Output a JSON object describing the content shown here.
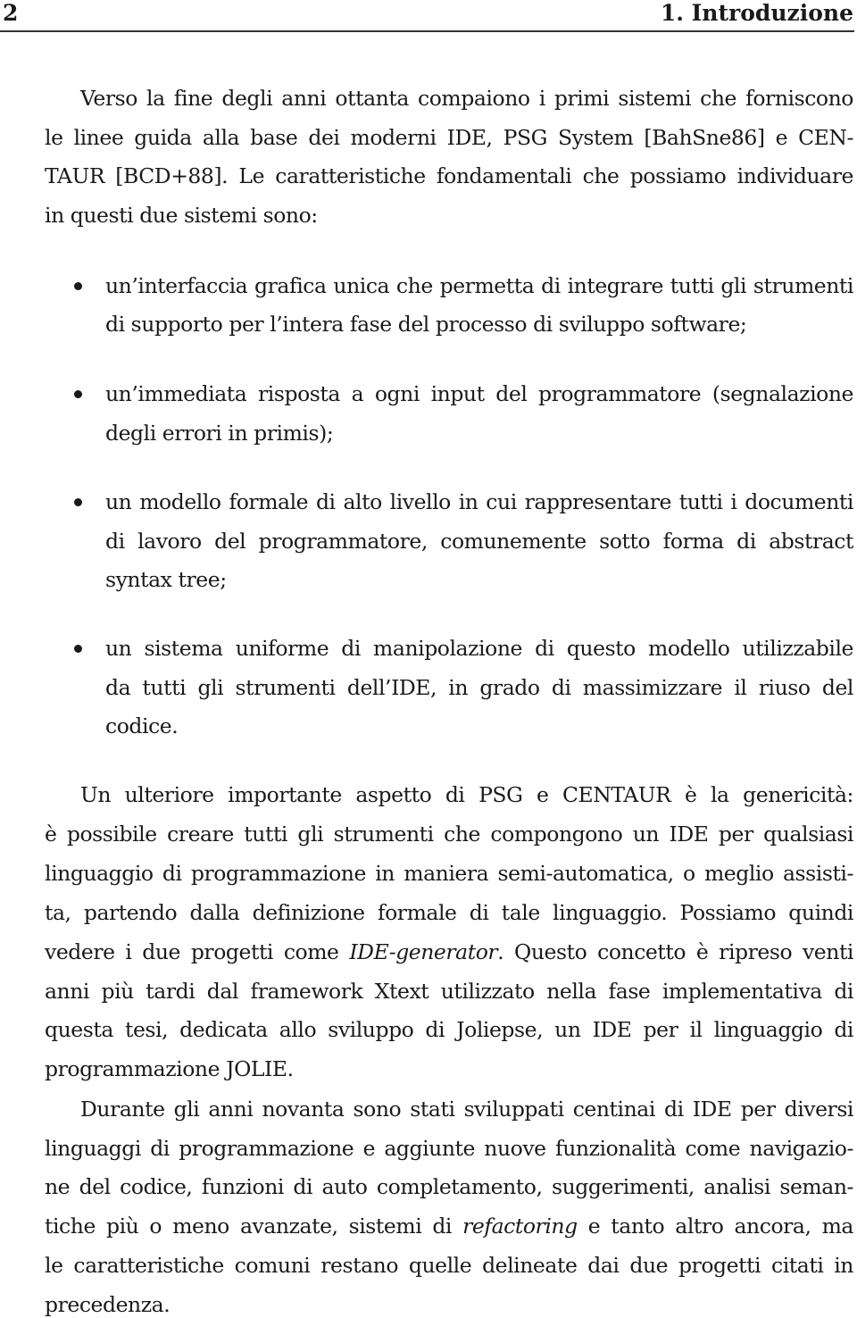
{
  "header": {
    "page_number": "2",
    "chapter": "1. Introduzione"
  },
  "paragraph1": [
    "Verso la fine degli anni ottanta compaiono i primi sistemi che forniscono",
    "le linee guida alla base dei moderni IDE, PSG System [BahSne86] e CEN-",
    "TAUR [BCD+88]. Le caratteristiche fondamentali che possiamo individuare",
    "in questi due sistemi sono:"
  ],
  "bullets": [
    [
      "un’interfaccia grafica unica che permetta di integrare tutti gli strumenti",
      "di supporto per l’intera fase del processo di sviluppo software;"
    ],
    [
      "un’immediata risposta a ogni input del programmatore (segnalazione",
      "degli errori in primis);"
    ],
    [
      "un modello formale di alto livello in cui rappresentare tutti i documenti",
      "di lavoro del programmatore, comunemente sotto forma di abstract",
      "syntax tree;"
    ],
    [
      "un sistema uniforme di manipolazione di questo modello utilizzabile",
      "da tutti gli strumenti dell’IDE, in grado di massimizzare il riuso del",
      "codice."
    ]
  ],
  "paragraph2": {
    "lines": [
      "Un ulteriore importante aspetto di PSG e CENTAUR è la genericità:",
      "è possibile creare tutti gli strumenti che compongono un IDE per qualsiasi",
      "linguaggio di programmazione in maniera semi-automatica, o meglio assisti-",
      "ta, partendo dalla definizione formale di tale linguaggio. Possiamo quindi"
    ],
    "line5_before": "vedere i due progetti come ",
    "line5_em": "IDE-generator",
    "line5_after": ". Questo concetto è ripreso venti",
    "lines_end": [
      "anni più tardi dal framework Xtext utilizzato nella fase implementativa di",
      "questa tesi, dedicata allo sviluppo di Joliepse, un IDE per il linguaggio di",
      "programmazione JOLIE."
    ]
  },
  "paragraph3": {
    "lines_start": [
      "Durante gli anni novanta sono stati sviluppati centinai di IDE per diversi",
      "linguaggi di programmazione e aggiunte nuove funzionalità come navigazio-",
      "ne del codice, funzioni di auto completamento, suggerimenti, analisi seman-"
    ],
    "line4_before": "tiche più o meno avanzate, sistemi di ",
    "line4_em": "refactoring",
    "line4_after": " e tanto altro ancora, ma",
    "lines_end": [
      "le caratteristiche comuni restano quelle delineate dai due progetti citati in",
      "precedenza."
    ]
  }
}
